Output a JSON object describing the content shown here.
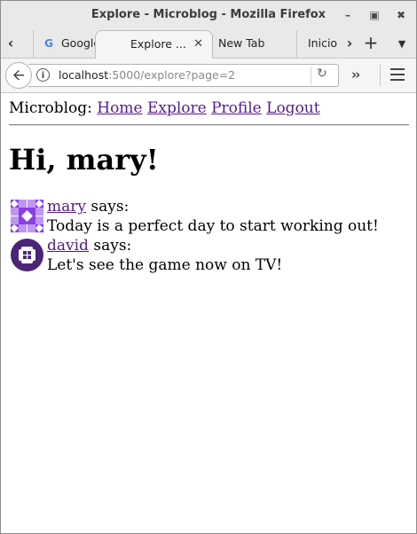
{
  "window": {
    "title": "Explore - Microblog - Mozilla Firefox",
    "controls": [
      "minimize-icon",
      "maximize-icon",
      "close-icon"
    ]
  },
  "tabs": [
    {
      "label": "Google",
      "icon": "google-icon"
    },
    {
      "label": "Explore ...",
      "active": true
    },
    {
      "label": "New Tab"
    },
    {
      "label": "Inicio"
    }
  ],
  "navbar": {
    "url_host": "localhost",
    "url_rest": ":5000/explore?page=2"
  },
  "page": {
    "brand": "Microblog:",
    "nav": [
      "Home",
      "Explore",
      "Profile",
      "Logout"
    ],
    "heading": "Hi, mary!",
    "posts": [
      {
        "user": "mary",
        "says": "says:",
        "body": "Today is a perfect day to start working out!",
        "avatar_color": "#8a3fe8"
      },
      {
        "user": "david",
        "says": "says:",
        "body": "Let's see the game now on TV!",
        "avatar_color": "#4a2577"
      }
    ]
  },
  "colors": {
    "link": "#551a8b",
    "chrome": "#e9e9e9"
  }
}
